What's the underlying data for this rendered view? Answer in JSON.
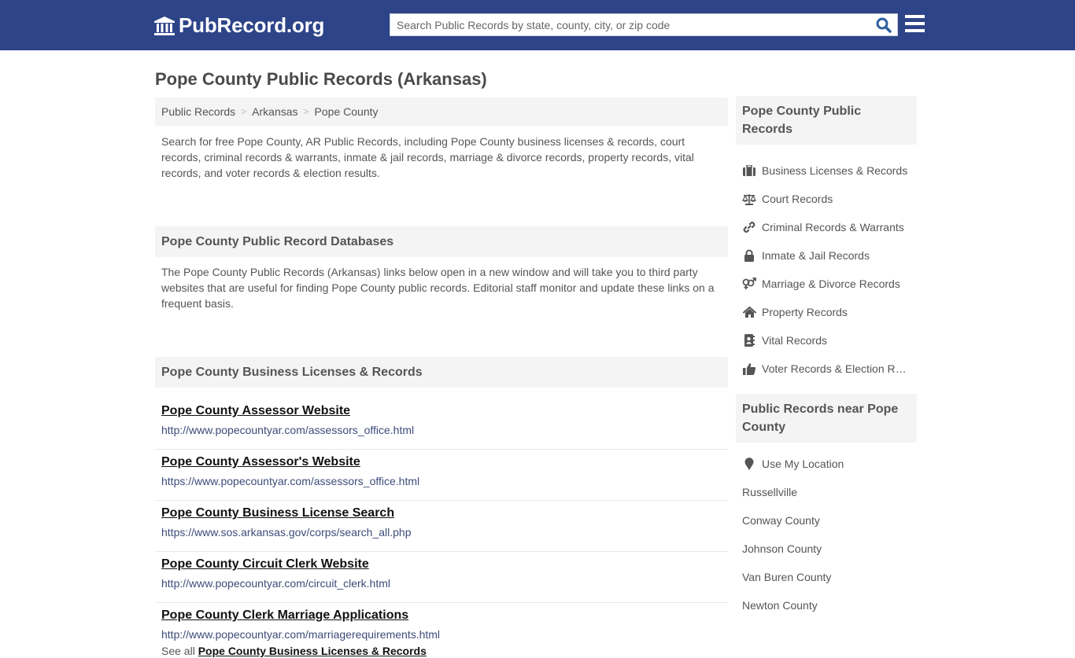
{
  "header": {
    "logo_text": "PubRecord.org",
    "search_placeholder": "Search Public Records by state, county, city, or zip code",
    "brand_color": "#2e4488"
  },
  "page_title": "Pope County Public Records (Arkansas)",
  "breadcrumb": [
    "Public Records",
    "Arkansas",
    "Pope County"
  ],
  "intro": "Search for free Pope County, AR Public Records, including Pope County business licenses & records, court records, criminal records & warrants, inmate & jail records, marriage & divorce records, property records, vital records, and voter records & election results.",
  "databases": {
    "heading": "Pope County Public Record Databases",
    "description": "The Pope County Public Records (Arkansas) links below open in a new window and will take you to third party websites that are useful for finding Pope County public records. Editorial staff monitor and update these links on a frequent basis."
  },
  "business": {
    "heading": "Pope County Business Licenses & Records",
    "records": [
      {
        "title": "Pope County Assessor Website",
        "url": "http://www.popecountyar.com/assessors_office.html"
      },
      {
        "title": "Pope County Assessor's Website",
        "url": "https://www.popecountyar.com/assessors_office.html"
      },
      {
        "title": "Pope County Business License Search",
        "url": "https://www.sos.arkansas.gov/corps/search_all.php"
      },
      {
        "title": "Pope County Circuit Clerk Website",
        "url": "http://www.popecountyar.com/circuit_clerk.html"
      },
      {
        "title": "Pope County Clerk Marriage Applications",
        "url": "http://www.popecountyar.com/marriagerequirements.html"
      }
    ],
    "see_all_prefix": "See all",
    "see_all_link": "Pope County Business Licenses & Records"
  },
  "sidebar": {
    "records_heading": "Pope County Public Records",
    "records_items": [
      {
        "label": "Business Licenses & Records",
        "icon": "briefcase-icon"
      },
      {
        "label": "Court Records",
        "icon": "balance-scale-icon"
      },
      {
        "label": "Criminal Records & Warrants",
        "icon": "link-icon"
      },
      {
        "label": "Inmate & Jail Records",
        "icon": "lock-icon"
      },
      {
        "label": "Marriage & Divorce Records",
        "icon": "venus-mars-icon"
      },
      {
        "label": "Property Records",
        "icon": "home-icon"
      },
      {
        "label": "Vital Records",
        "icon": "address-book-icon"
      },
      {
        "label": "Voter Records & Election Results",
        "icon": "thumbs-up-icon"
      }
    ],
    "near_heading": "Public Records near Pope County",
    "use_location": "Use My Location",
    "near_items": [
      "Russellville",
      "Conway County",
      "Johnson County",
      "Van Buren County",
      "Newton County"
    ]
  }
}
